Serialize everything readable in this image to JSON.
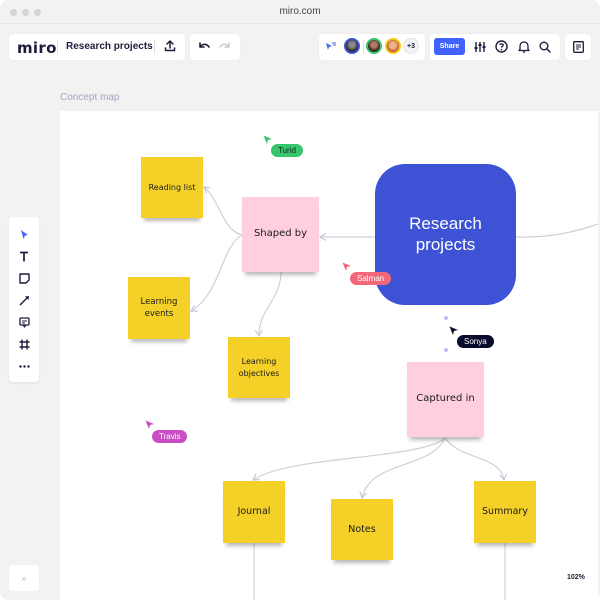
{
  "browser": {
    "url": "miro.com"
  },
  "header": {
    "logo": "miro",
    "board_title": "Research projects",
    "icons": {
      "upload": "upload-icon",
      "undo": "undo-icon",
      "redo": "redo-icon"
    }
  },
  "collaborators": {
    "cursor_follow_icon": "cursor-follow-icon",
    "avatars": [
      {
        "name": "avatar-1",
        "ring": "#3e52d6"
      },
      {
        "name": "avatar-2",
        "ring": "#38c66d"
      },
      {
        "name": "avatar-3",
        "ring": "#f5c518"
      }
    ],
    "more_count": "+3"
  },
  "actions": {
    "share_label": "Share",
    "icons": [
      "settings-sliders-icon",
      "help-icon",
      "notifications-bell-icon",
      "search-icon"
    ],
    "board_menu_icon": "board-menu-icon"
  },
  "frame": {
    "label": "Concept map"
  },
  "tools": [
    {
      "name": "select-tool",
      "icon": "cursor-icon",
      "active": true
    },
    {
      "name": "text-tool",
      "icon": "text-icon"
    },
    {
      "name": "sticky-note-tool",
      "icon": "sticky-note-icon"
    },
    {
      "name": "connection-line-tool",
      "icon": "arrow-line-icon"
    },
    {
      "name": "comment-tool",
      "icon": "comment-icon"
    },
    {
      "name": "frame-tool",
      "icon": "frame-icon"
    },
    {
      "name": "more-tools",
      "icon": "more-dots-icon"
    }
  ],
  "expand_panel_label": "»",
  "center_node": {
    "label": "Research\nprojects",
    "line1": "Research",
    "line2": "projects",
    "color": "#3e52d6"
  },
  "stickies": {
    "reading_list": "Reading list",
    "shaped_by": "Shaped by",
    "learning_events_1": "Learning",
    "learning_events_2": "events",
    "learning_objectives_1": "Learning",
    "learning_objectives_2": "objectives",
    "captured_in": "Captured in",
    "journal": "Journal",
    "notes": "Notes",
    "summary": "Summary"
  },
  "sticky_colors": {
    "yellow": "#f5d128",
    "pink": "#ffcee0"
  },
  "cursors": [
    {
      "name": "Turid",
      "color": "#38c66d"
    },
    {
      "name": "Salman",
      "color": "#f26878"
    },
    {
      "name": "Sonya",
      "color": "#090b2b"
    },
    {
      "name": "Travis",
      "color": "#c94ec4"
    }
  ],
  "zoom_level": "102%"
}
